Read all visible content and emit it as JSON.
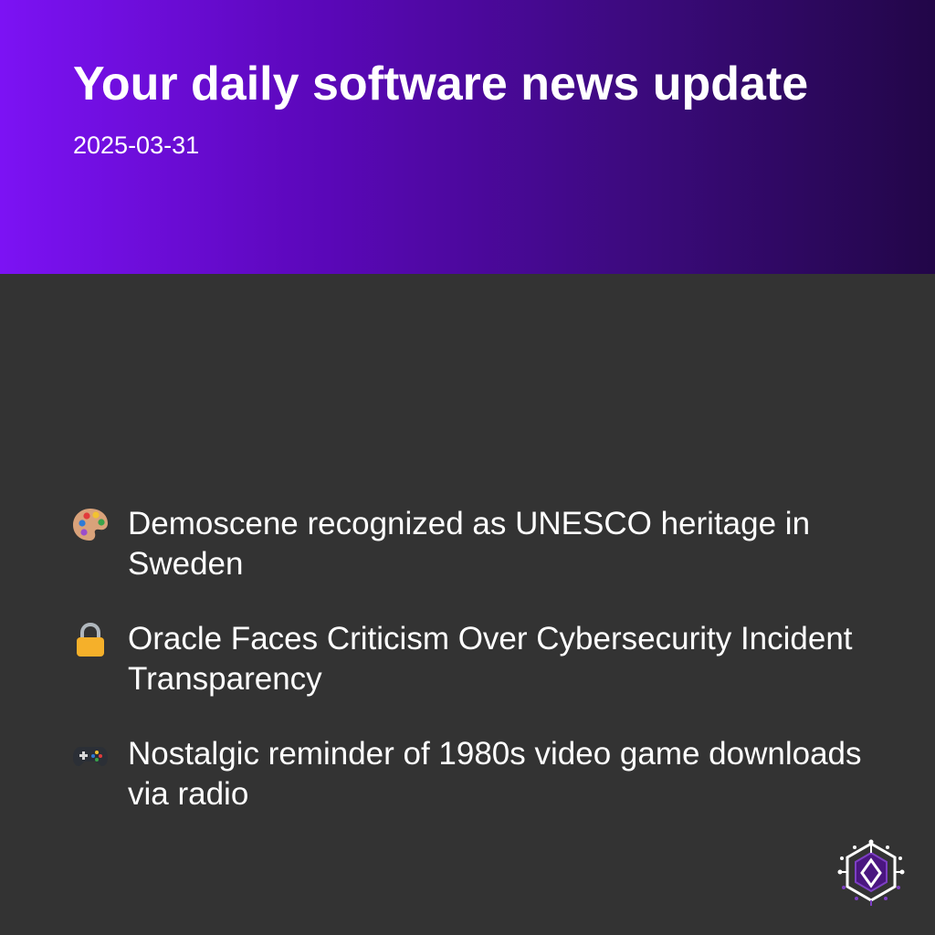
{
  "header": {
    "title": "Your daily software news update",
    "date": "2025-03-31"
  },
  "news": [
    {
      "icon": "artist-palette-icon",
      "text": "Demoscene recognized as UNESCO heritage in Sweden"
    },
    {
      "icon": "lock-icon",
      "text": "Oracle Faces Criticism Over Cybersecurity Incident Transparency"
    },
    {
      "icon": "game-controller-icon",
      "text": "Nostalgic reminder of 1980s video game downloads via radio"
    }
  ],
  "colors": {
    "background": "#333333",
    "header_gradient_start": "#7c12f4",
    "header_gradient_end": "#220648",
    "text": "#ffffff"
  },
  "logo": {
    "icon": "circuit-hexagon-logo-icon"
  }
}
